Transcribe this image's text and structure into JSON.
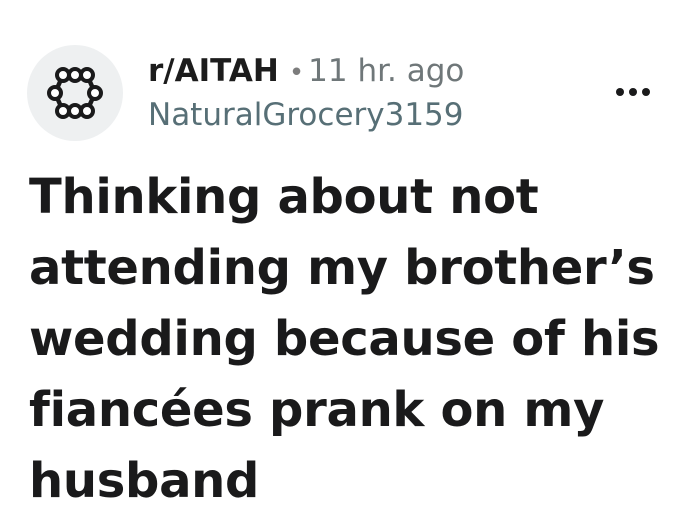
{
  "post": {
    "subreddit": "r/AITAH",
    "separator": "•",
    "time_ago": "11 hr. ago",
    "author": "NaturalGrocery3159",
    "title": "Thinking about not attending my brother’s wedding because of his fiancées prank on my husband"
  },
  "icons": {
    "avatar": "subreddit-avatar-icon",
    "more": "more-options-icon"
  },
  "colors": {
    "avatar_bg": "#eef0f1",
    "text_primary": "#1a1a1b",
    "text_muted": "#576f76"
  }
}
